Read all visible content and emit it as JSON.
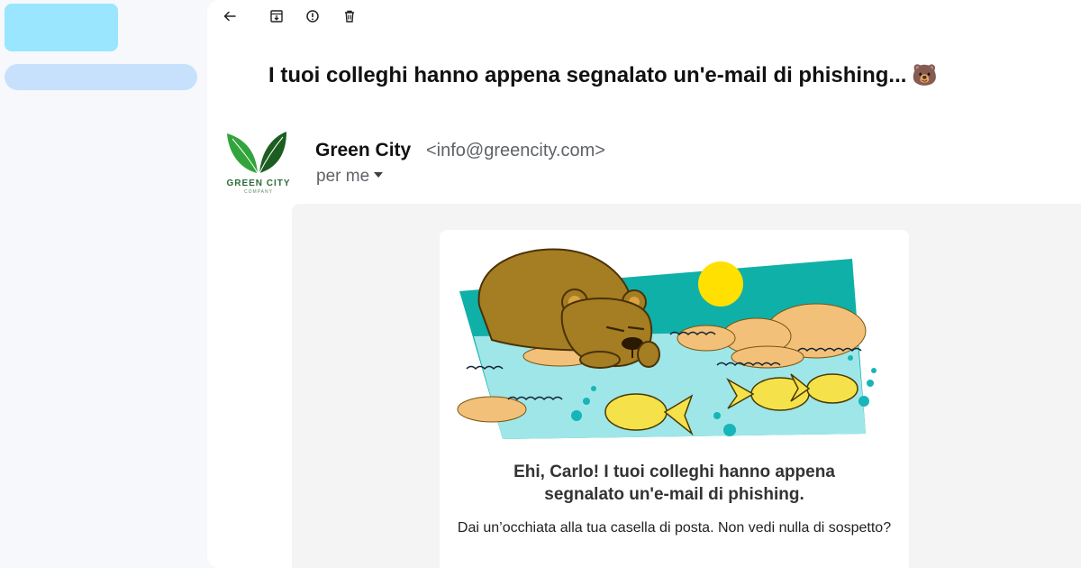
{
  "toolbar": {
    "back_icon": "arrow-left-icon",
    "archive_icon": "archive-icon",
    "spam_icon": "report-spam-icon",
    "delete_icon": "trash-icon"
  },
  "email": {
    "subject": "I tuoi colleghi hanno appena segnalato un'e-mail di phishing...",
    "subject_emoji": "🐻",
    "sender_name": "Green City",
    "sender_email": "<info@greencity.com>",
    "recipient": "per me",
    "logo": {
      "text": "GREEN CITY",
      "subtext": "COMPANY"
    }
  },
  "content": {
    "headline_line1": "Ehi, Carlo! I tuoi colleghi hanno appena",
    "headline_line2": "segnalato un'e-mail di phishing.",
    "message": "Dai un’occhiata alla tua casella di posta. Non vedi nulla di sospetto?"
  },
  "colors": {
    "sidebar_top": "#99e6fe",
    "sidebar_nav": "#c7e1fd",
    "teal": "#0fb0a8",
    "water": "#9fe6e8",
    "sun": "#ffe000",
    "bear": "#a57d22",
    "sand": "#f2c078",
    "fish": "#f5e24a",
    "leaf": "#2a7d2e"
  }
}
